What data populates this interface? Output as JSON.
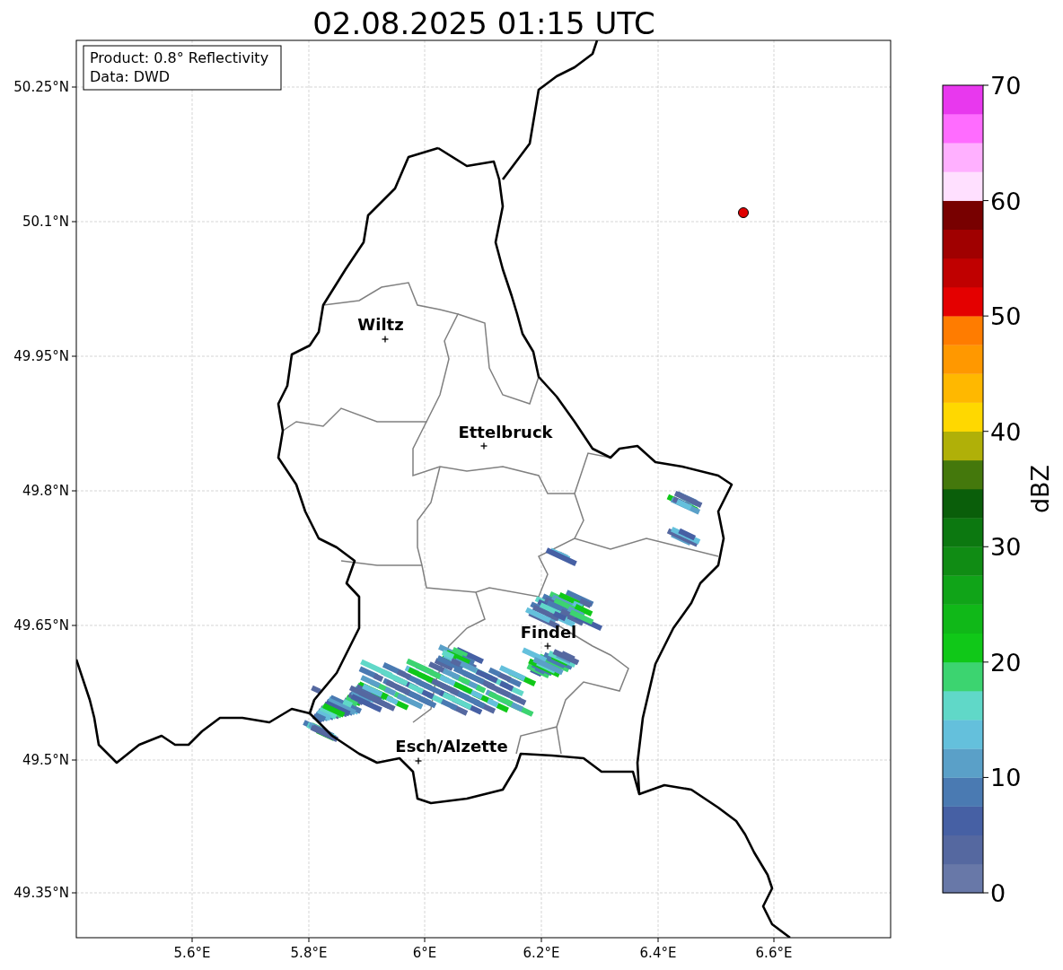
{
  "title": "02.08.2025 01:15 UTC",
  "info_box": [
    "Product: 0.8° Reflectivity",
    "Data: DWD"
  ],
  "map": {
    "x_ticks": [
      "5.6°E",
      "5.8°E",
      "6°E",
      "6.2°E",
      "6.4°E",
      "6.6°E"
    ],
    "y_ticks": [
      "50.25°N",
      "50.1°N",
      "49.95°N",
      "49.8°N",
      "49.65°N",
      "49.5°N",
      "49.35°N"
    ],
    "cities": [
      {
        "name": "Wiltz"
      },
      {
        "name": "Ettelbruck"
      },
      {
        "name": "Findel"
      },
      {
        "name": "Esch/Alzette"
      }
    ]
  },
  "colorbar": {
    "label": "dBZ",
    "ticks": [
      "70",
      "60",
      "50",
      "40",
      "30",
      "20",
      "10",
      "0"
    ],
    "bins": [
      {
        "color": "#6878a8"
      },
      {
        "color": "#5568a0"
      },
      {
        "color": "#4660a4"
      },
      {
        "color": "#4a7ab2"
      },
      {
        "color": "#5aa0c8"
      },
      {
        "color": "#64c0dc"
      },
      {
        "color": "#60d8c8"
      },
      {
        "color": "#3cd470"
      },
      {
        "color": "#10c818"
      },
      {
        "color": "#10b818"
      },
      {
        "color": "#10a418"
      },
      {
        "color": "#108c14"
      },
      {
        "color": "#0c7810"
      },
      {
        "color": "#0a5e0a"
      },
      {
        "color": "#44780c"
      },
      {
        "color": "#b0b008"
      },
      {
        "color": "#ffd800"
      },
      {
        "color": "#ffb800"
      },
      {
        "color": "#ff9800"
      },
      {
        "color": "#ff7c00"
      },
      {
        "color": "#e40000"
      },
      {
        "color": "#c00000"
      },
      {
        "color": "#a00000"
      },
      {
        "color": "#780000"
      },
      {
        "color": "#ffe0ff"
      },
      {
        "color": "#ffb0ff"
      },
      {
        "color": "#ff6cff"
      },
      {
        "color": "#e838ee"
      }
    ]
  }
}
